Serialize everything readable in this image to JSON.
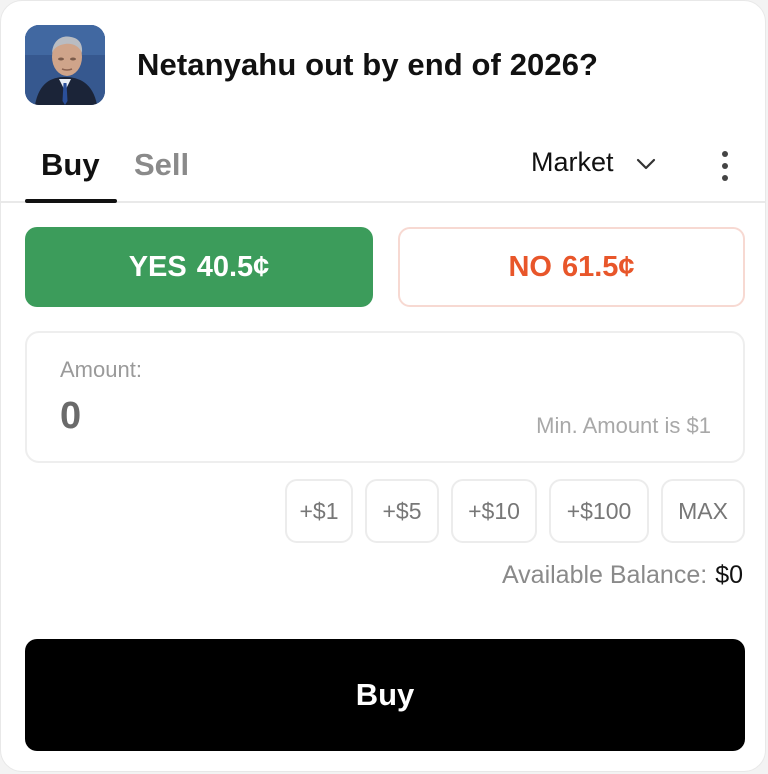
{
  "market": {
    "title": "Netanyahu out by end of 2026?",
    "avatar_icon": "portrait-photo"
  },
  "tabs": {
    "buy_label": "Buy",
    "sell_label": "Sell",
    "active": "Buy"
  },
  "order_type": {
    "selected": "Market",
    "chevron_icon": "chevron-down-icon",
    "more_icon": "vertical-ellipsis-icon"
  },
  "outcomes": {
    "yes": {
      "label": "YES",
      "price": "40.5¢",
      "color": "#3c9c5b"
    },
    "no": {
      "label": "NO",
      "price": "61.5¢",
      "color": "#e8562a"
    }
  },
  "amount": {
    "label": "Amount:",
    "value": "0",
    "hint": "Min. Amount is $1"
  },
  "quick_amounts": [
    "+$1",
    "+$5",
    "+$10",
    "+$100",
    "MAX"
  ],
  "balance": {
    "label": "Available Balance:",
    "value": "$0"
  },
  "submit": {
    "label": "Buy"
  }
}
